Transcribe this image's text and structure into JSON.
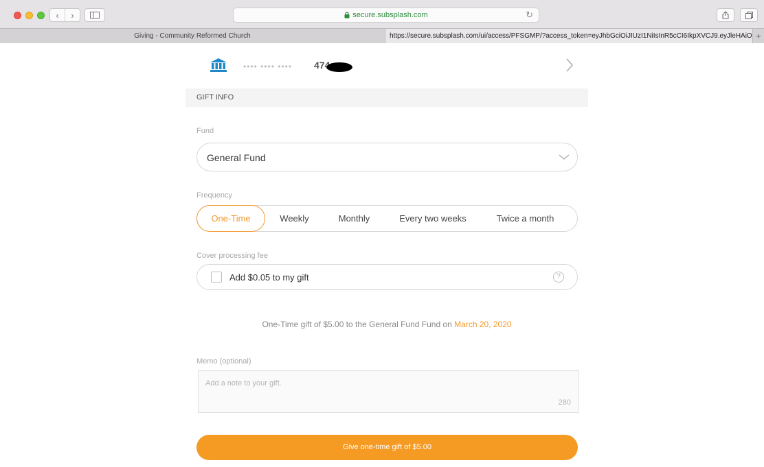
{
  "browser": {
    "url": "secure.subsplash.com",
    "tabs": [
      {
        "title": "Giving - Community Reformed Church"
      },
      {
        "title": "https://secure.subsplash.com/ui/access/PFSGMP/?access_token=eyJhbGciOiJIUzI1NiIsInR5cCI6IkpXVCJ9.eyJleHAiOj..."
      }
    ],
    "new_tab_label": "+"
  },
  "payment": {
    "card_mask": "•••• •••• ••••",
    "card_last": "474",
    "bank_icon": "bank-icon",
    "chevron_icon": "chevron-right-icon"
  },
  "gift_info": {
    "section_title": "GIFT INFO",
    "fund_label": "Fund",
    "fund_value": "General Fund",
    "frequency_label": "Frequency",
    "frequency_options": [
      "One-Time",
      "Weekly",
      "Monthly",
      "Every two weeks",
      "Twice a month"
    ],
    "frequency_selected": "One-Time",
    "fee_label": "Cover processing fee",
    "fee_checkbox_label": "Add $0.05 to my gift",
    "help_glyph": "?",
    "summary_text": "One-Time gift of $5.00 to the General Fund Fund on ",
    "summary_date": "March 20, 2020",
    "memo_label": "Memo (optional)",
    "memo_placeholder": "Add a note to your gift.",
    "memo_remaining": "280",
    "submit_label": "Give one-time gift of $5.00"
  },
  "colors": {
    "accent": "#f59a23",
    "bank_icon": "#1e88c8"
  }
}
